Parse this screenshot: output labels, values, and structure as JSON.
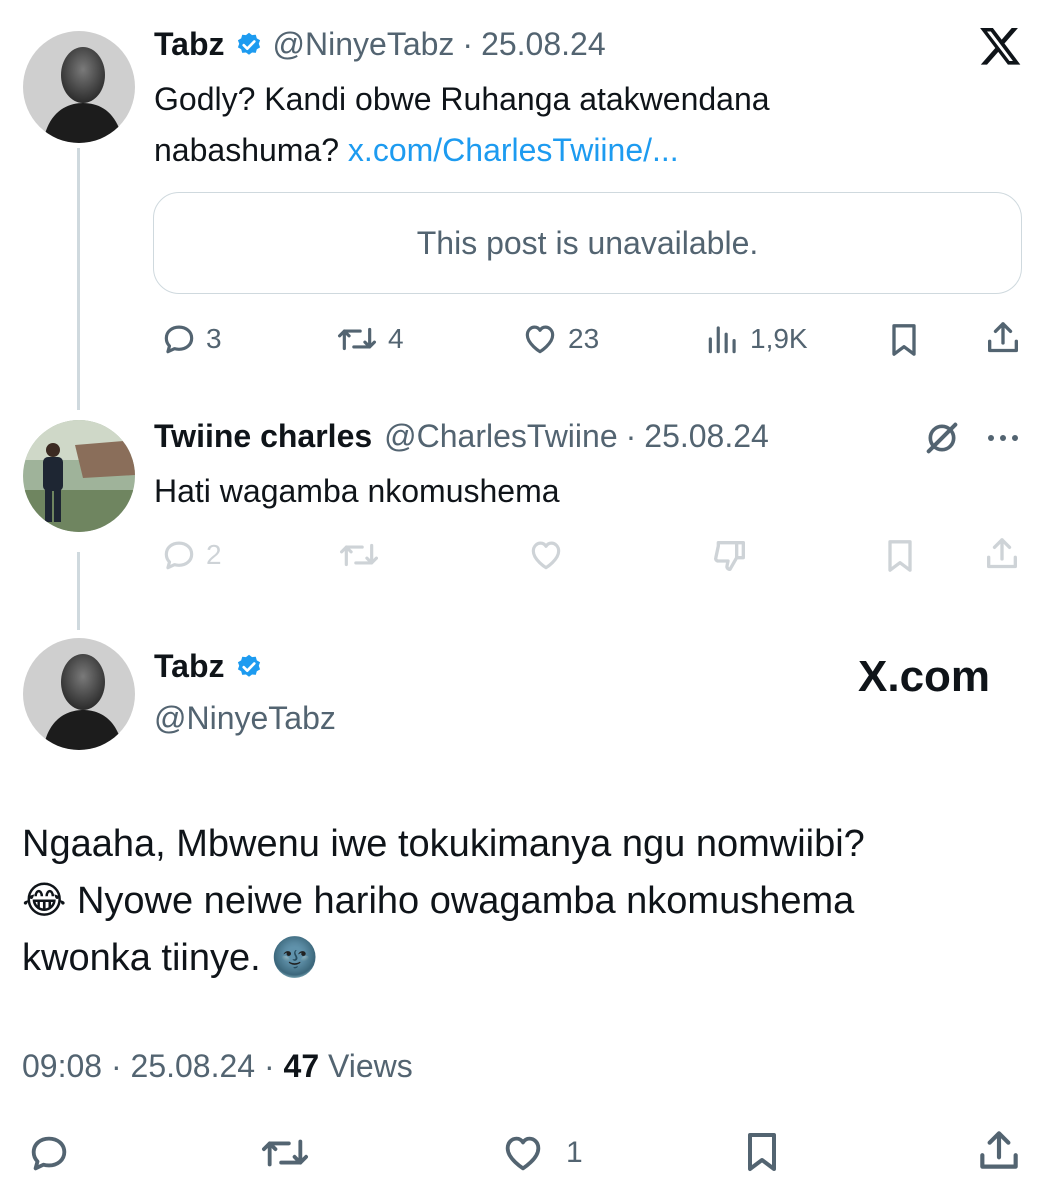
{
  "tweet1": {
    "name": "Tabz",
    "handle": "@NinyeTabz",
    "sep": "·",
    "date": "25.08.24",
    "text_part1": "Godly? Kandi obwe Ruhanga atakwendana",
    "text_part2": "nabashuma?",
    "link": "x.com/CharlesTwiine/...",
    "quote_unavailable": "This post is unavailable.",
    "replies": "3",
    "reposts": "4",
    "likes": "23",
    "views": "1,9K"
  },
  "tweet2": {
    "name": "Twiine charles",
    "handle": "@CharlesTwiine",
    "sep": "·",
    "date": "25.08.24",
    "text": "Hati wagamba nkomushema",
    "replies": "2"
  },
  "main_tweet": {
    "name": "Tabz",
    "handle": "@NinyeTabz",
    "brand": "X.com",
    "text_line1": "Ngaaha, Mbwenu iwe tokukimanya ngu nomwiibi?",
    "emoji1": "😂",
    "text_line2": "Nyowe neiwe hariho owagamba nkomushema",
    "text_line3": "kwonka tiinye.",
    "emoji2": "🌚",
    "time": "09:08",
    "sep": "·",
    "date": "25.08.24",
    "views_count": "47",
    "views_label": "Views",
    "likes": "1"
  },
  "icons": {
    "logo": "x-logo-icon",
    "verified": "verified-badge-icon",
    "reply": "reply-icon",
    "repost": "repost-icon",
    "like": "heart-icon",
    "views": "views-icon",
    "bookmark": "bookmark-icon",
    "share": "share-icon",
    "grok": "grok-icon",
    "more": "more-icon",
    "downvote": "downvote-icon"
  },
  "colors": {
    "verified": "#1d9bf0",
    "link": "#1d9bf0",
    "secondary": "#536471",
    "primary": "#0f1419"
  }
}
